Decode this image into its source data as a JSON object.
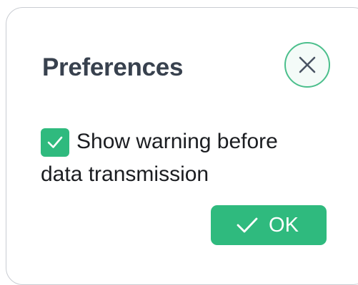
{
  "dialog": {
    "title": "Preferences",
    "close_icon": "close-icon",
    "checkbox": {
      "checked": true,
      "label": "Show warning before data transmission",
      "icon": "checkmark-icon"
    },
    "ok_button": {
      "label": "OK",
      "icon": "checkmark-icon"
    }
  },
  "colors": {
    "accent": "#2fba7e",
    "title": "#38414e",
    "text": "#1b1d21",
    "border": "#c9ccd2"
  }
}
